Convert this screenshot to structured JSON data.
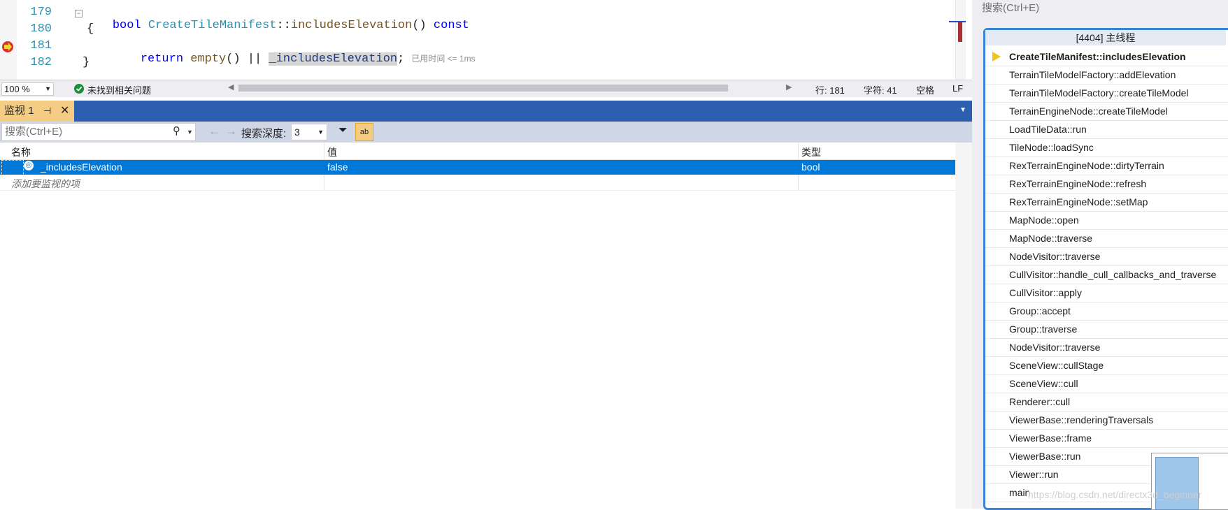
{
  "editor": {
    "lines": [
      {
        "num": "179",
        "text_parts": [
          "bool ",
          "CreateTileManifest",
          "::",
          "includesElevation",
          "() ",
          "const"
        ]
      },
      {
        "num": "180",
        "text": "{"
      },
      {
        "num": "181",
        "text_parts": [
          "return ",
          "empty",
          "() || ",
          "_includesElevation",
          ";"
        ],
        "timing": "已用时间 <= 1ms"
      },
      {
        "num": "182",
        "text": "}"
      }
    ],
    "status": {
      "zoom": "100 %",
      "issues": "未找到相关问题",
      "line": "行: 181",
      "char": "字符: 41",
      "spaces": "空格",
      "eol": "LF"
    }
  },
  "watch": {
    "tab_label": "监视 1",
    "search_placeholder": "搜索(Ctrl+E)",
    "depth_label": "搜索深度:",
    "depth_value": "3",
    "columns": [
      "名称",
      "值",
      "类型"
    ],
    "rows": [
      {
        "name": "_includesElevation",
        "value": "false",
        "type": "bool"
      }
    ],
    "add_placeholder": "添加要监视的项"
  },
  "callstack": {
    "search_placeholder": "搜索(Ctrl+E)",
    "thread_title": "[4404] 主线程",
    "frames": [
      "CreateTileManifest::includesElevation",
      "TerrainTileModelFactory::addElevation",
      "TerrainTileModelFactory::createTileModel",
      "TerrainEngineNode::createTileModel",
      "LoadTileData::run",
      "TileNode::loadSync",
      "RexTerrainEngineNode::dirtyTerrain",
      "RexTerrainEngineNode::refresh",
      "RexTerrainEngineNode::setMap",
      "MapNode::open",
      "MapNode::traverse",
      "NodeVisitor::traverse",
      "CullVisitor::handle_cull_callbacks_and_traverse",
      "CullVisitor::apply",
      "Group::accept",
      "Group::traverse",
      "NodeVisitor::traverse",
      "SceneView::cullStage",
      "SceneView::cull",
      "Renderer::cull",
      "ViewerBase::renderingTraversals",
      "ViewerBase::frame",
      "ViewerBase::run",
      "Viewer::run",
      "main"
    ]
  },
  "watermark": "https://blog.csdn.net/directx3d_beginner",
  "colors": {
    "accent": "#0078d7",
    "tab": "#f5cc84",
    "tabbar": "#2d5fb0"
  }
}
